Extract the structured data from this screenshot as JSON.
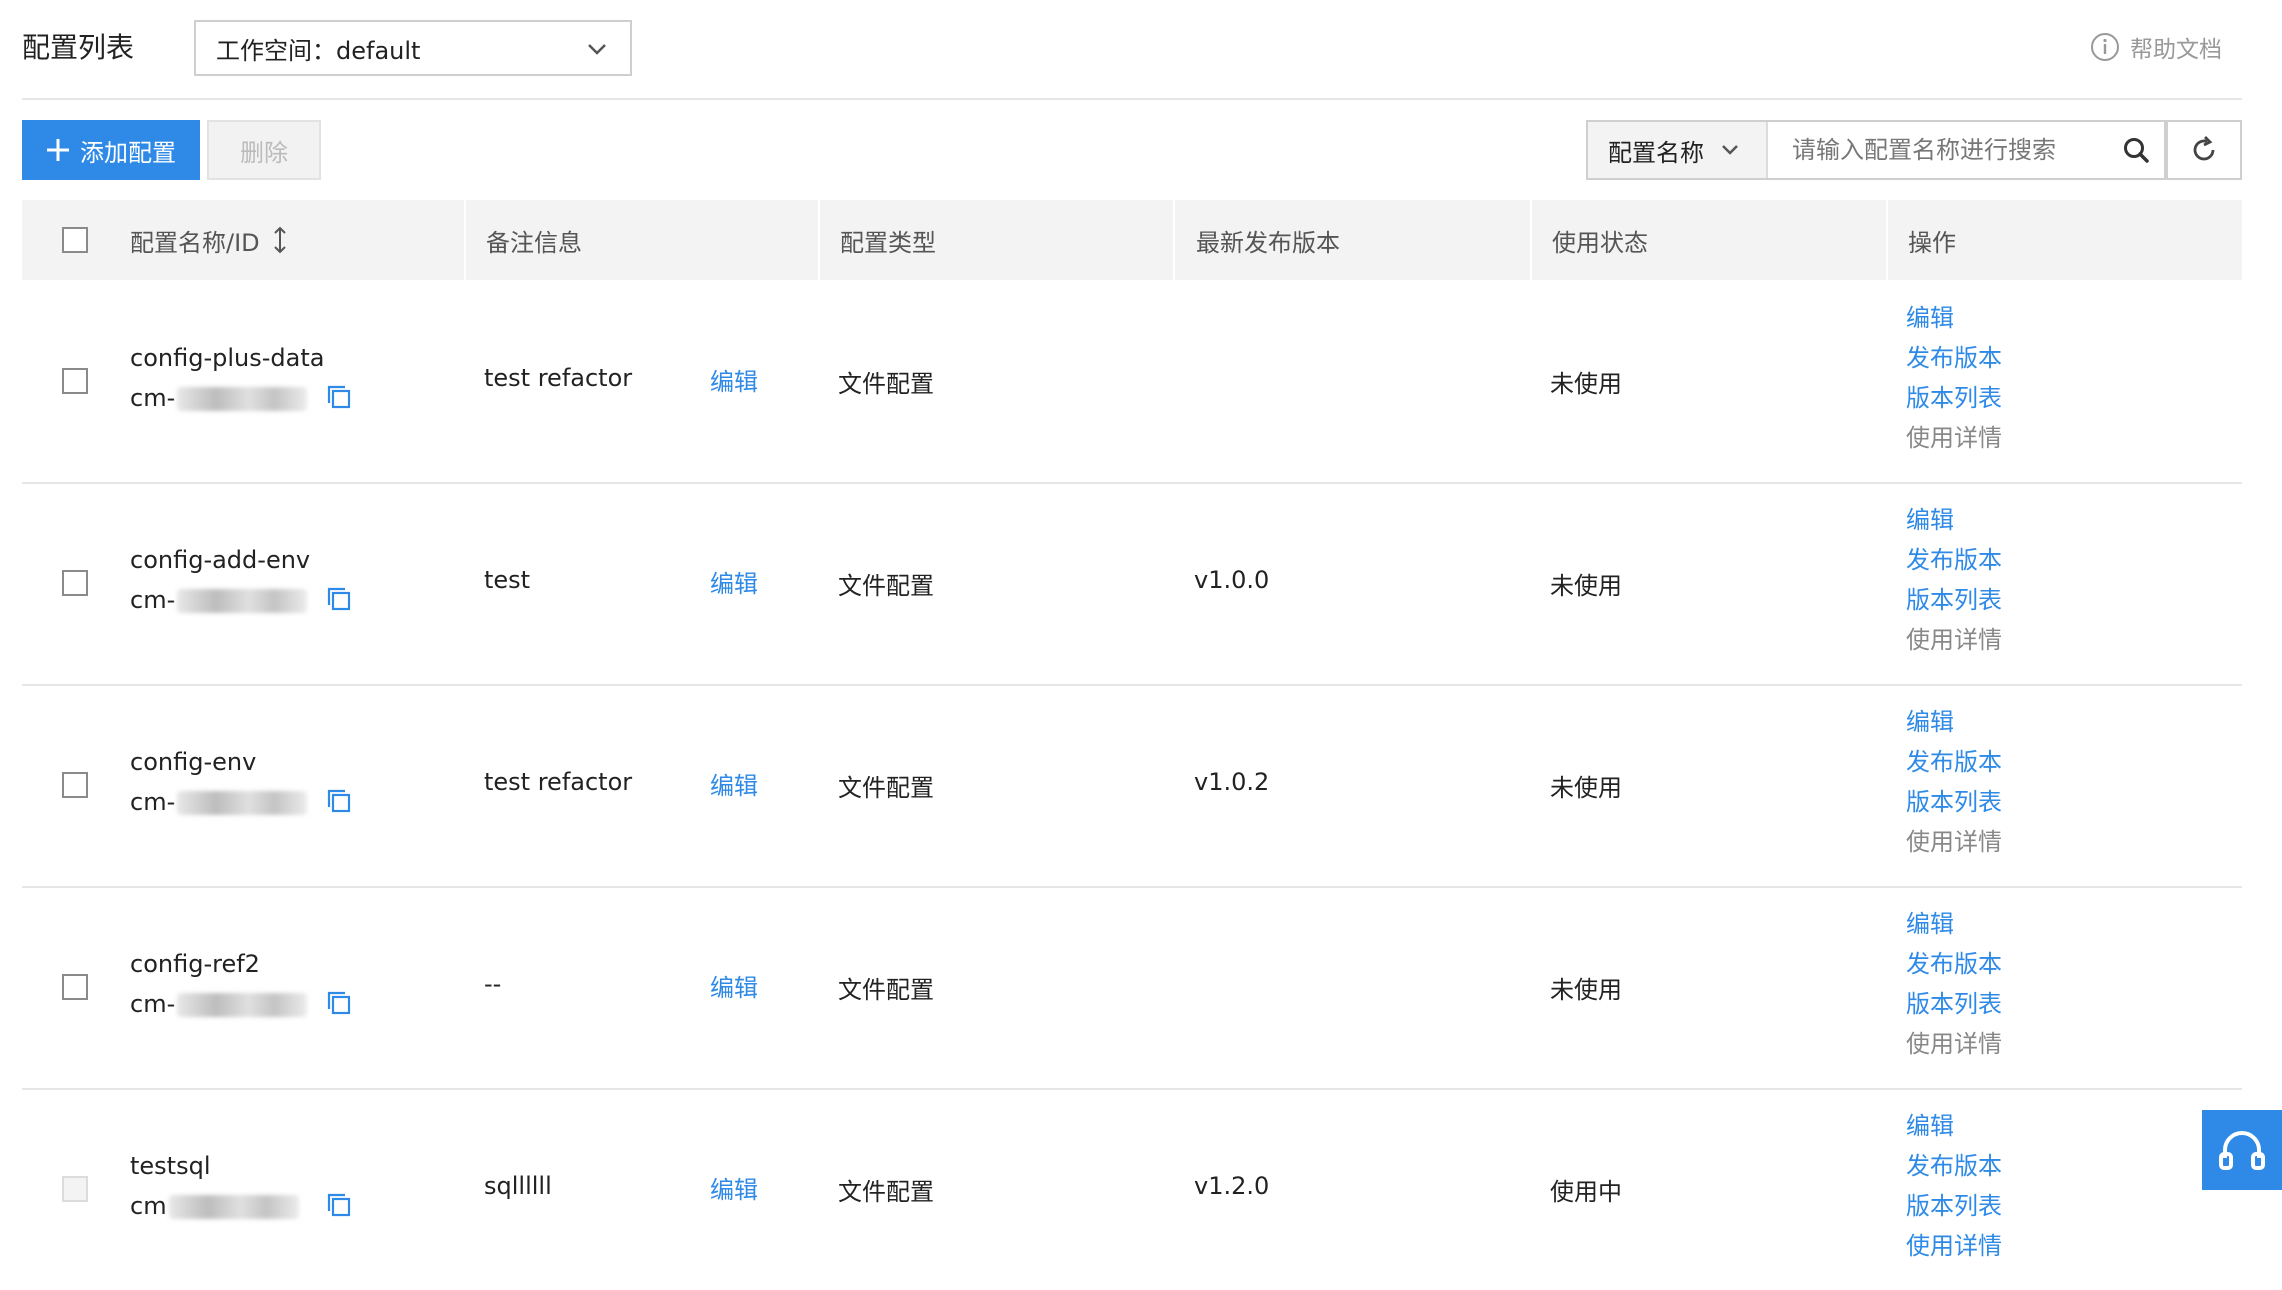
{
  "header": {
    "title": "配置列表",
    "workspace_label": "工作空间：default",
    "help_label": "帮助文档"
  },
  "toolbar": {
    "add_label": "添加配置",
    "delete_label": "删除",
    "search_type": "配置名称",
    "search_placeholder": "请输入配置名称进行搜索"
  },
  "table": {
    "columns": [
      "配置名称/ID",
      "备注信息",
      "配置类型",
      "最新发布版本",
      "使用状态",
      "操作"
    ],
    "edit_label": "编辑",
    "ops": [
      "编辑",
      "发布版本",
      "版本列表",
      "使用详情"
    ],
    "rows": [
      {
        "name": "config-plus-data",
        "id_prefix": "cm-",
        "remark": "test refactor",
        "type": "文件配置",
        "version": "",
        "status": "未使用"
      },
      {
        "name": "config-add-env",
        "id_prefix": "cm-",
        "remark": "test",
        "type": "文件配置",
        "version": "v1.0.0",
        "status": "未使用"
      },
      {
        "name": "config-env",
        "id_prefix": "cm-",
        "remark": "test refactor",
        "type": "文件配置",
        "version": "v1.0.2",
        "status": "未使用"
      },
      {
        "name": "config-ref2",
        "id_prefix": "cm-",
        "remark": "--",
        "type": "文件配置",
        "version": "",
        "status": "未使用"
      },
      {
        "name": "testsql",
        "id_prefix": "cm",
        "remark": "sqllllll",
        "type": "文件配置",
        "version": "v1.2.0",
        "status": "使用中"
      }
    ]
  },
  "colors": {
    "primary": "#2e8ae6",
    "header_bg": "#f3f3f3",
    "border": "#e6e6e6"
  }
}
